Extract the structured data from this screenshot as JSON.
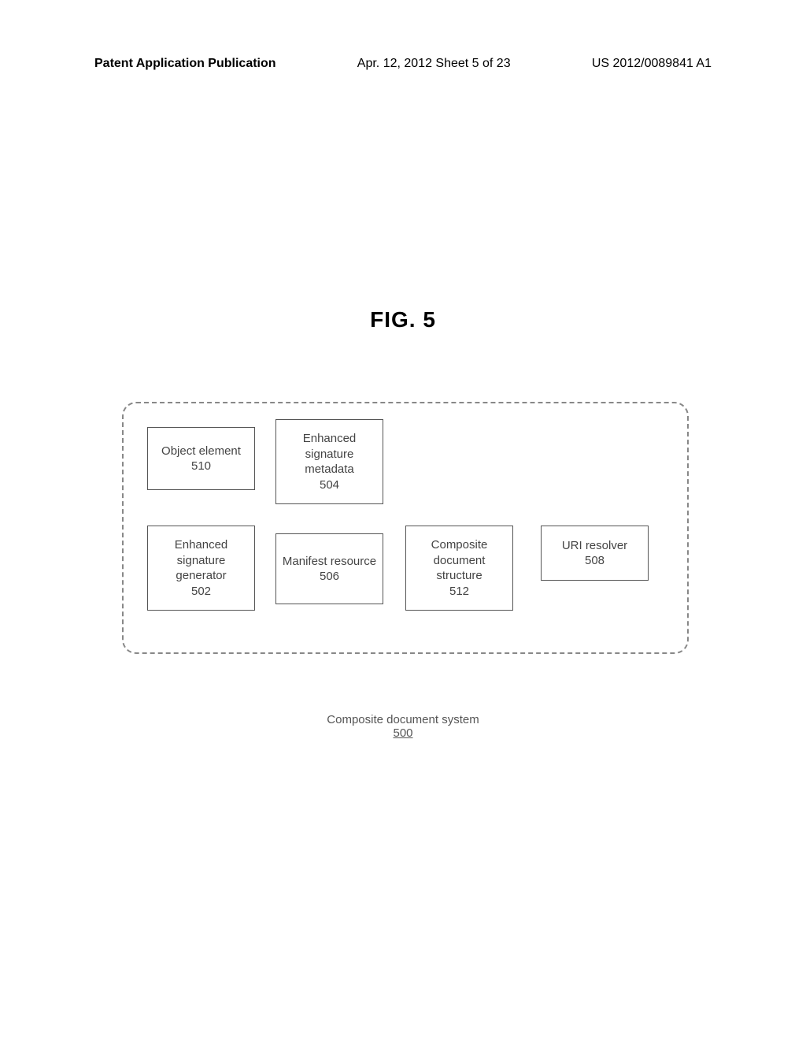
{
  "header": {
    "left": "Patent Application Publication",
    "center": "Apr. 12, 2012  Sheet 5 of 23",
    "right": "US 2012/0089841 A1"
  },
  "figure_title": "FIG. 5",
  "blocks": {
    "object_element": {
      "label": "Object element",
      "number": "510"
    },
    "enh_sig_meta": {
      "label": "Enhanced signature metadata",
      "number": "504"
    },
    "enh_sig_gen": {
      "label": "Enhanced signature generator",
      "number": "502"
    },
    "manifest": {
      "label": "Manifest resource",
      "number": "506"
    },
    "composite_struct": {
      "label": "Composite document structure",
      "number": "512"
    },
    "uri_resolver": {
      "label": "URI resolver",
      "number": "508"
    }
  },
  "caption": {
    "label": "Composite document system",
    "number": "500"
  }
}
